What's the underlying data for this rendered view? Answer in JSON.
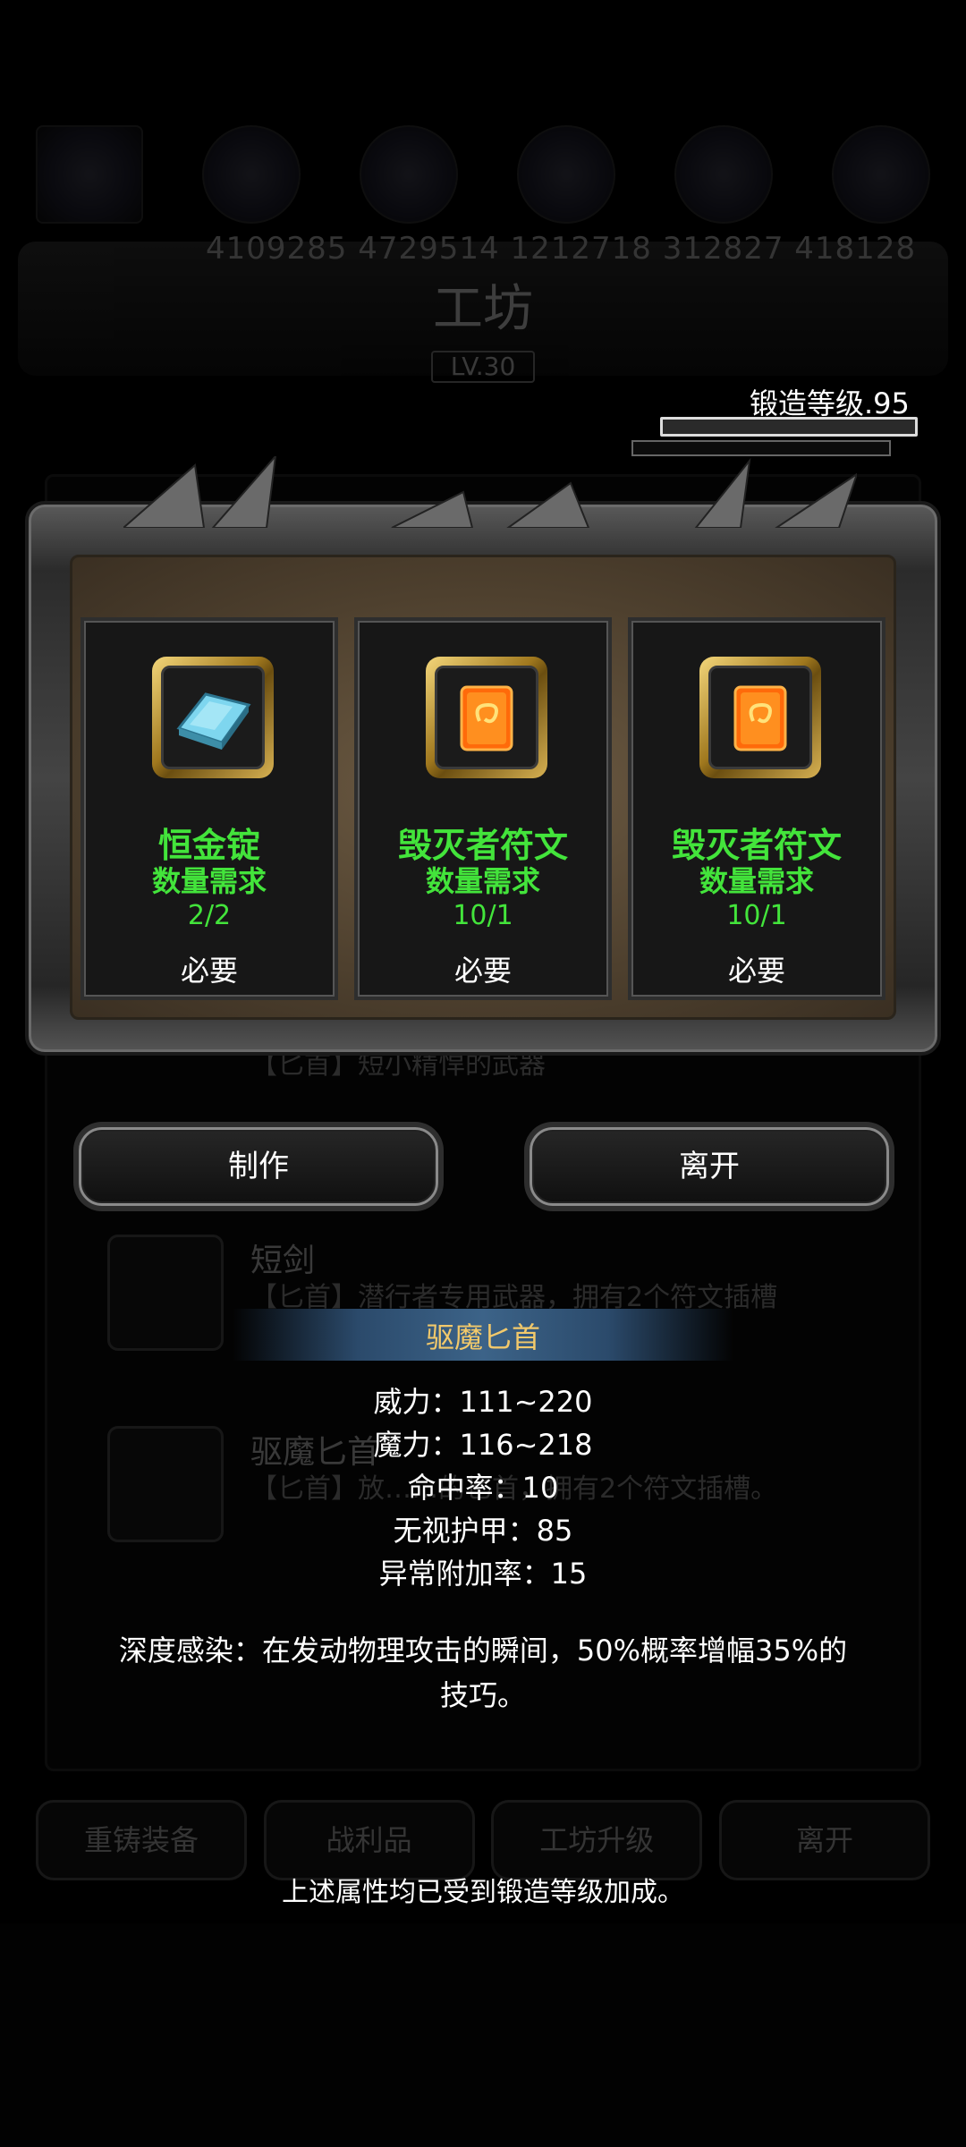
{
  "background": {
    "numbers": "4109285  4729514  1212718  312827  418128",
    "title": "工坊",
    "level_badge": "LV.30",
    "list_items": [
      {
        "name": "",
        "desc": "【匕首】短小精悍的武器"
      },
      {
        "name": "短剑",
        "desc": "【匕首】潜行者专用武器，拥有2个符文插槽"
      },
      {
        "name": "驱魔匕首",
        "desc": "【匕首】放……的匕首，拥有2个符文插槽。"
      }
    ],
    "tabs": [
      "重铸装备",
      "战利品",
      "工坊升级",
      "离开"
    ]
  },
  "forge": {
    "level_label": "锻造等级.95"
  },
  "materials": [
    {
      "name": "恒金锭",
      "requirement_label": "数量需求",
      "count": "2/2",
      "tag": "必要",
      "icon": "ingot-icon",
      "color": "#5fc3dd"
    },
    {
      "name": "毁灭者符文",
      "requirement_label": "数量需求",
      "count": "10/1",
      "tag": "必要",
      "icon": "rune-icon",
      "color": "#ff6a0a"
    },
    {
      "name": "毁灭者符文",
      "requirement_label": "数量需求",
      "count": "10/1",
      "tag": "必要",
      "icon": "rune-icon",
      "color": "#ff6a0a"
    }
  ],
  "buttons": {
    "make": "制作",
    "leave": "离开"
  },
  "item": {
    "title": "驱魔匕首",
    "stats": [
      "威力：111~220",
      "魔力：116~218",
      "命中率：10",
      "无视护甲：85",
      "异常附加率：15"
    ],
    "effect": "深度感染：在发动物理攻击的瞬间，50%概率增幅35%的技巧。",
    "note": "上述属性均已受到锻造等级加成。"
  },
  "colors": {
    "requirement_green": "#43e43b",
    "title_gold": "#f2c96b"
  }
}
